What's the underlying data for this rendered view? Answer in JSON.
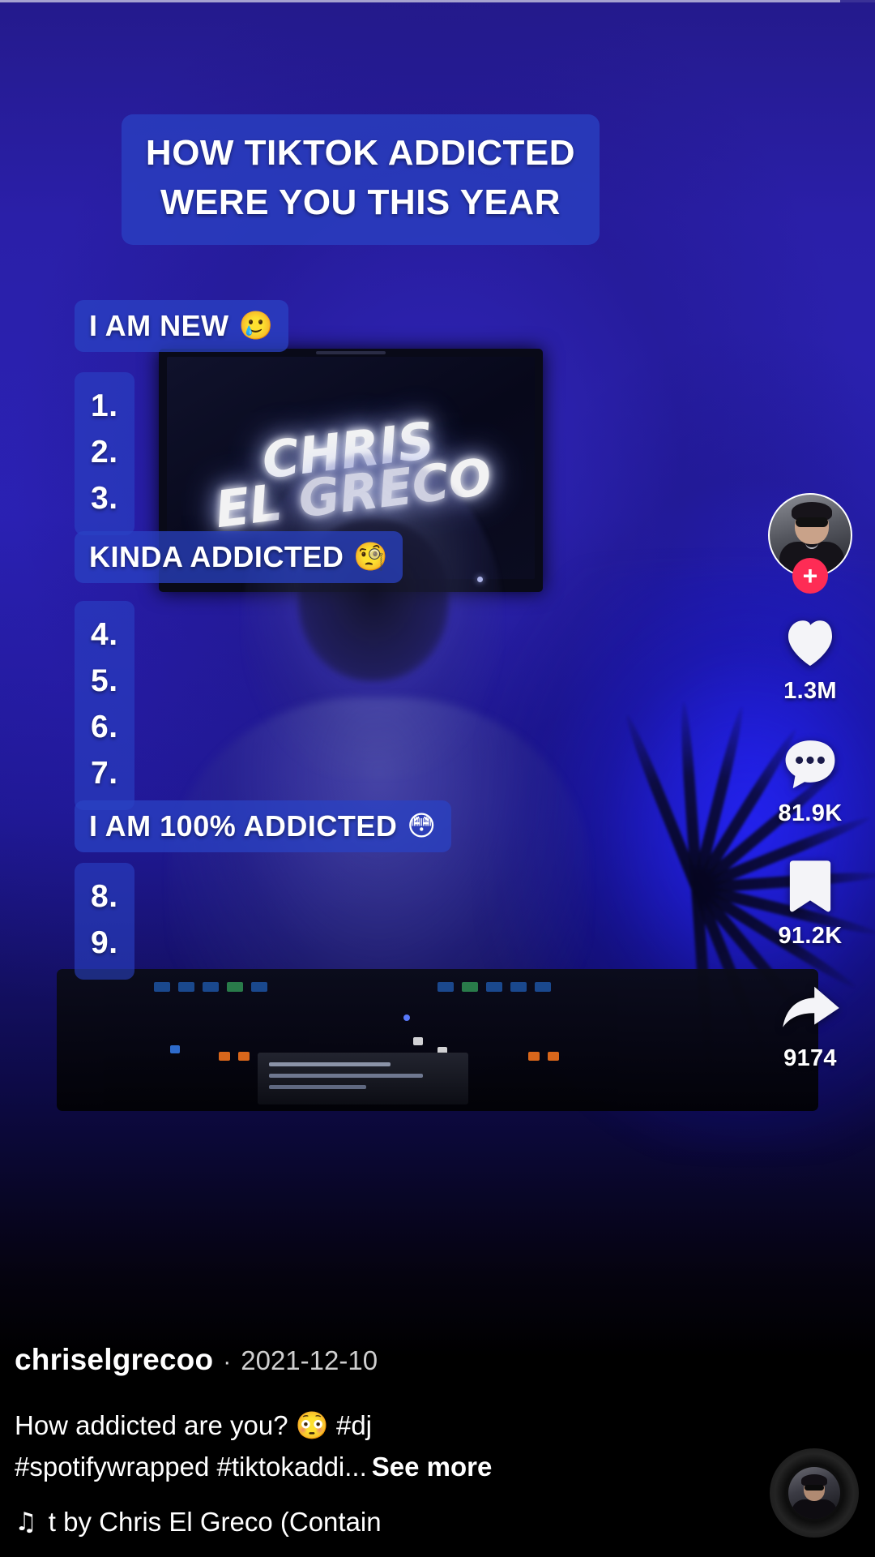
{
  "app": {
    "name": "TikTok"
  },
  "video": {
    "title_sticker": {
      "line1": "HOW TIKTOK ADDICTED",
      "line2": "WERE YOU THIS YEAR"
    },
    "categories": [
      {
        "label": "I AM NEW",
        "emoji": "🥲",
        "items": [
          "1.",
          "2.",
          "3."
        ]
      },
      {
        "label": "KINDA ADDICTED",
        "emoji": "🧐",
        "items": [
          "4.",
          "5.",
          "6.",
          "7."
        ]
      },
      {
        "label": "I AM 100% ADDICTED",
        "emoji": "😳",
        "items": [
          "8.",
          "9."
        ]
      }
    ],
    "neon_sign": "CHRIS\nEL GRECO"
  },
  "actions": {
    "follow_label": "+",
    "like": {
      "icon": "heart-icon",
      "count": "1.3M"
    },
    "comment": {
      "icon": "comment-icon",
      "count": "81.9K"
    },
    "bookmark": {
      "icon": "bookmark-icon",
      "count": "91.2K"
    },
    "share": {
      "icon": "share-icon",
      "count": "9174"
    }
  },
  "post": {
    "author": "chriselgrecoo",
    "separator": "·",
    "date": "2021-12-10",
    "caption_line1": "How addicted are you? 😳 #dj",
    "caption_line2": "#spotifywrapped #tiktokaddi...",
    "see_more": "See more",
    "music_note": "♫",
    "music_title": "t by Chris El Greco (Contain"
  },
  "colors": {
    "accent_pink": "#fe2c55",
    "sticker_blue": "#2a42c4",
    "text_white": "#ffffff"
  }
}
